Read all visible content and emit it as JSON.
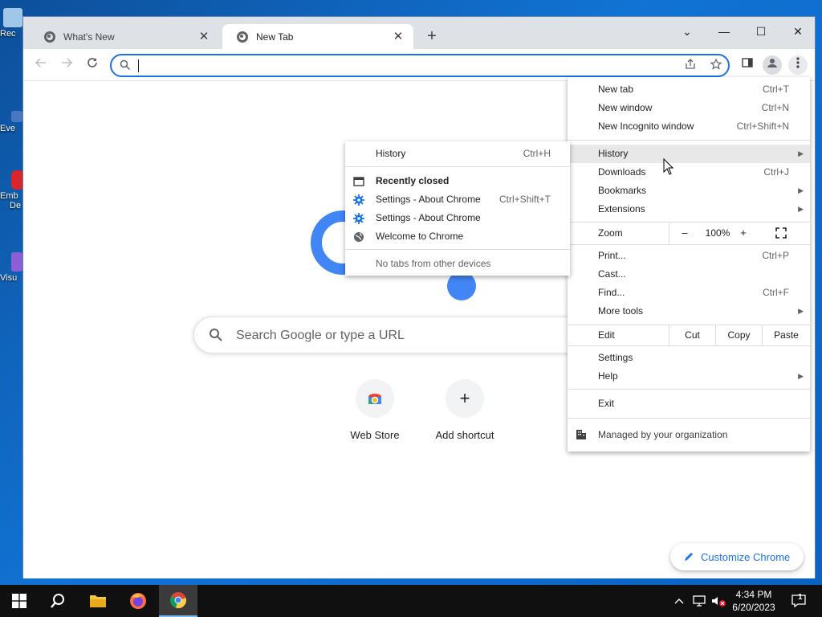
{
  "desktop": {
    "icons": [
      {
        "label": "Rec",
        "color": "#9fc8e8"
      },
      {
        "label": "Eve",
        "color": "#4a78c0"
      },
      {
        "label": "Emb",
        "sublabel": "De",
        "color": "#d9262e"
      },
      {
        "label": "Visu",
        "color": "#8b5fd6"
      }
    ]
  },
  "browser": {
    "tabs": [
      {
        "title": "What's New",
        "close": "✕"
      },
      {
        "title": "New Tab",
        "close": "✕"
      }
    ],
    "new_tab_button": "+",
    "window_controls": {
      "tab_search": "⌄",
      "minimize": "—",
      "maximize": "☐",
      "close": "✕"
    },
    "omnibox": {
      "value": "",
      "placeholder": ""
    }
  },
  "ntp": {
    "search_placeholder": "Search Google or type a URL",
    "shortcuts": [
      {
        "label": "Web Store",
        "icon": "webstore-icon"
      },
      {
        "label": "Add shortcut",
        "icon": "plus-icon"
      }
    ],
    "customize_label": "Customize Chrome"
  },
  "chrome_menu": {
    "new_tab": {
      "label": "New tab",
      "shortcut": "Ctrl+T"
    },
    "new_window": {
      "label": "New window",
      "shortcut": "Ctrl+N"
    },
    "new_incognito": {
      "label": "New Incognito window",
      "shortcut": "Ctrl+Shift+N"
    },
    "history": {
      "label": "History"
    },
    "downloads": {
      "label": "Downloads",
      "shortcut": "Ctrl+J"
    },
    "bookmarks": {
      "label": "Bookmarks"
    },
    "extensions": {
      "label": "Extensions"
    },
    "zoom": {
      "label": "Zoom",
      "minus": "–",
      "value": "100%",
      "plus": "+"
    },
    "print": {
      "label": "Print...",
      "shortcut": "Ctrl+P"
    },
    "cast": {
      "label": "Cast..."
    },
    "find": {
      "label": "Find...",
      "shortcut": "Ctrl+F"
    },
    "more_tools": {
      "label": "More tools"
    },
    "edit": {
      "label": "Edit",
      "cut": "Cut",
      "copy": "Copy",
      "paste": "Paste"
    },
    "settings": {
      "label": "Settings"
    },
    "help": {
      "label": "Help"
    },
    "exit": {
      "label": "Exit"
    },
    "managed": {
      "label": "Managed by your organization"
    }
  },
  "history_menu": {
    "history": {
      "label": "History",
      "shortcut": "Ctrl+H"
    },
    "recently_closed": "Recently closed",
    "items": [
      {
        "label": "Settings - About Chrome",
        "shortcut": "Ctrl+Shift+T",
        "icon": "gear-icon"
      },
      {
        "label": "Settings - About Chrome",
        "shortcut": "",
        "icon": "gear-icon"
      },
      {
        "label": "Welcome to Chrome",
        "shortcut": "",
        "icon": "globe-icon"
      }
    ],
    "no_tabs": "No tabs from other devices"
  },
  "taskbar": {
    "time": "4:34 PM",
    "date": "6/20/2023",
    "notification_count": "1"
  },
  "colors": {
    "accent": "#1a73e8",
    "google_blue": "#4285f4",
    "tabstrip": "#dee1e6"
  }
}
